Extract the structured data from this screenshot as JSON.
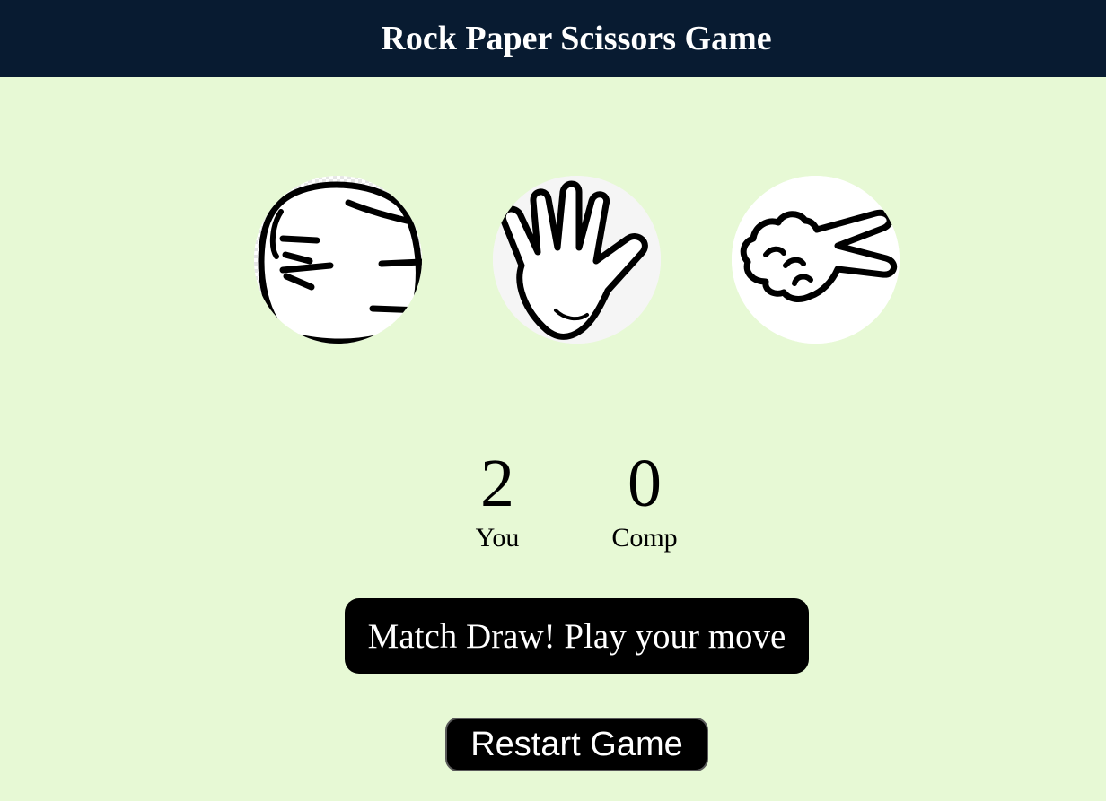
{
  "header": {
    "title": "Rock Paper Scissors Game"
  },
  "choices": [
    {
      "id": "rock",
      "icon": "rock-fist-icon"
    },
    {
      "id": "paper",
      "icon": "paper-hand-icon"
    },
    {
      "id": "scissors",
      "icon": "scissors-hand-icon"
    }
  ],
  "scoreboard": {
    "user_score": "2",
    "user_label": "You",
    "comp_score": "0",
    "comp_label": "Comp"
  },
  "message": {
    "text": "Match Draw! Play your move"
  },
  "controls": {
    "restart_label": "Restart Game"
  },
  "colors": {
    "header_bg": "#081b31",
    "page_bg": "#e7f9d5",
    "message_bg": "#000000",
    "button_bg": "#000000"
  }
}
